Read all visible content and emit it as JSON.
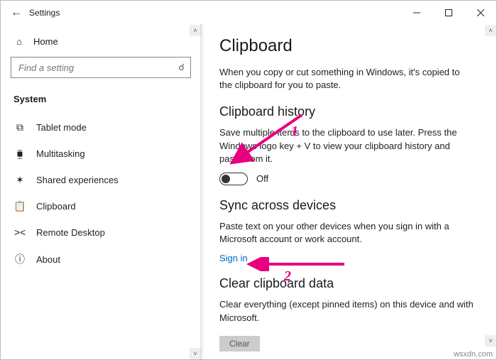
{
  "titlebar": {
    "app_name": "Settings"
  },
  "sidebar": {
    "home_label": "Home",
    "search_placeholder": "Find a setting",
    "section_heading": "System",
    "items": [
      {
        "icon": "tablet-icon",
        "glyph": "⧉",
        "label": "Tablet mode"
      },
      {
        "icon": "multitasking-icon",
        "glyph": "⧯",
        "label": "Multitasking"
      },
      {
        "icon": "shared-experiences-icon",
        "glyph": "✶",
        "label": "Shared experiences"
      },
      {
        "icon": "clipboard-icon",
        "glyph": "📋",
        "label": "Clipboard"
      },
      {
        "icon": "remote-desktop-icon",
        "glyph": "><",
        "label": "Remote Desktop"
      },
      {
        "icon": "about-icon",
        "glyph": "ⓘ",
        "label": "About"
      }
    ]
  },
  "main": {
    "heading": "Clipboard",
    "intro": "When you copy or cut something in Windows, it's copied to the clipboard for you to paste.",
    "history": {
      "heading": "Clipboard history",
      "desc": "Save multiple items to the clipboard to use later. Press the Windows logo key + V to view your clipboard history and paste from it.",
      "toggle_state": "Off"
    },
    "sync": {
      "heading": "Sync across devices",
      "desc": "Paste text on your other devices when you sign in with a Microsoft account or work account.",
      "link": "Sign in"
    },
    "clear": {
      "heading": "Clear clipboard data",
      "desc": "Clear everything (except pinned items) on this device and with Microsoft.",
      "button": "Clear"
    }
  },
  "annotations": {
    "num1": "1",
    "num2": "2"
  },
  "watermark": "wsxdn.com"
}
